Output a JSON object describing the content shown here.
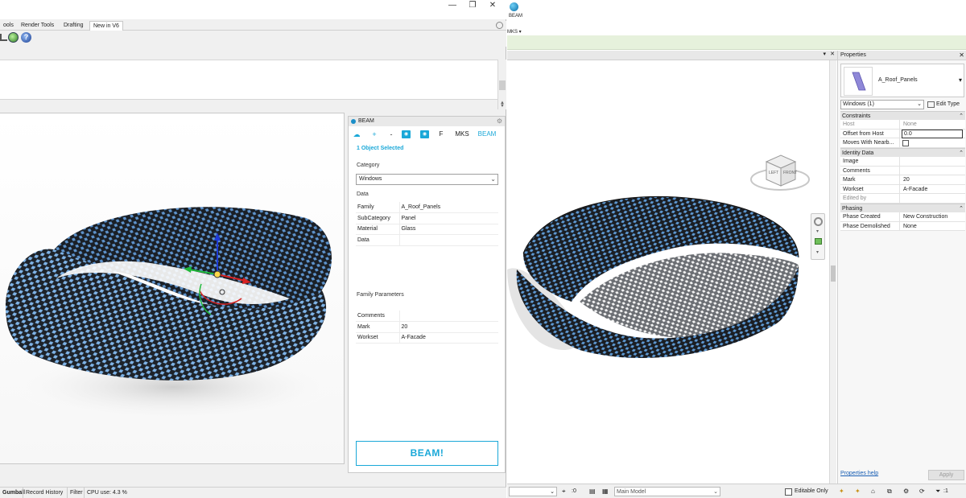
{
  "rhino": {
    "window_controls": {
      "minimize": "—",
      "restore": "❐",
      "close": "✕"
    },
    "tabs": [
      {
        "label": "ools"
      },
      {
        "label": "Render Tools"
      },
      {
        "label": "Drafting"
      },
      {
        "label": "New in V6"
      }
    ],
    "status_bar": {
      "gumball": "Gumball",
      "record_history": "Record History",
      "filter": "Filter",
      "cpu": "CPU use: 4.3 %"
    },
    "beam_panel": {
      "title": "BEAM",
      "toolbar": {
        "add": "+",
        "remove": "-",
        "f": "F",
        "mks": "MKS",
        "beam": "BEAM"
      },
      "selection_status": "1 Object Selected",
      "category_label": "Category",
      "category_value": "Windows",
      "data_label": "Data",
      "data_rows": [
        {
          "key": "Family",
          "value": "A_Roof_Panels"
        },
        {
          "key": "SubCategory",
          "value": "Panel"
        },
        {
          "key": "Material",
          "value": "Glass"
        },
        {
          "key": "Data",
          "value": ""
        }
      ],
      "family_params_label": "Family Parameters",
      "family_params": [
        {
          "key": "Comments",
          "value": ""
        },
        {
          "key": "Mark",
          "value": "20"
        },
        {
          "key": "Workset",
          "value": "A-Facade"
        }
      ],
      "action_button": "BEAM!"
    }
  },
  "revit": {
    "ribbon": {
      "beam_label": "BEAM",
      "mks_label": "MKS ▾"
    },
    "view_cube": {
      "left": "LEFT",
      "front": "FRONT"
    },
    "properties": {
      "title": "Properties",
      "close": "✕",
      "type_name": "A_Roof_Panels",
      "instance_filter": "Windows (1)",
      "edit_type": "Edit Type",
      "groups": {
        "constraints": {
          "label": "Constraints",
          "rows": [
            {
              "key": "Host",
              "value": "None"
            },
            {
              "key": "Offset from Host",
              "value": "0.0"
            },
            {
              "key": "Moves With Nearb...",
              "value": ""
            }
          ]
        },
        "identity": {
          "label": "Identity Data",
          "rows": [
            {
              "key": "Image",
              "value": ""
            },
            {
              "key": "Comments",
              "value": ""
            },
            {
              "key": "Mark",
              "value": "20"
            },
            {
              "key": "Workset",
              "value": "A-Facade"
            },
            {
              "key": "Edited by",
              "value": ""
            }
          ]
        },
        "phasing": {
          "label": "Phasing",
          "rows": [
            {
              "key": "Phase Created",
              "value": "New Construction"
            },
            {
              "key": "Phase Demolished",
              "value": "None"
            }
          ]
        }
      },
      "help_link": "Properties help",
      "apply_button": "Apply"
    },
    "status_bar": {
      "selection_count": ":0",
      "model": "Main Model",
      "editable_only": "Editable Only",
      "filter_count": ":1"
    }
  },
  "colors": {
    "accent": "#1aa8d8",
    "mobius_dark": "#1c2026",
    "mobius_blue": "#6aa6e0"
  }
}
